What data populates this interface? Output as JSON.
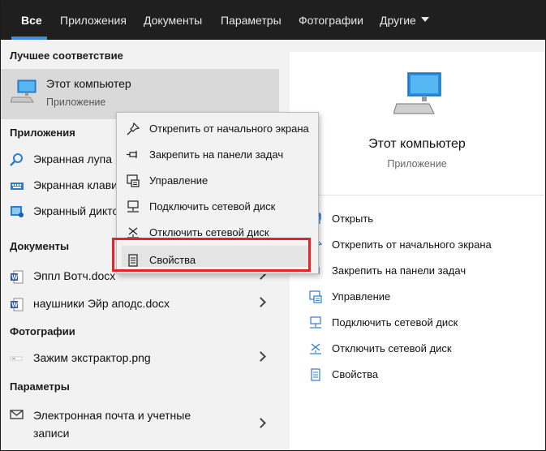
{
  "tabs": [
    {
      "label": "Все"
    },
    {
      "label": "Приложения"
    },
    {
      "label": "Документы"
    },
    {
      "label": "Параметры"
    },
    {
      "label": "Фотографии"
    },
    {
      "label": "Другие"
    }
  ],
  "left": {
    "best_match_header": "Лучшее соответствие",
    "best_match": {
      "title": "Этот компьютер",
      "subtitle": "Приложение"
    },
    "apps_header": "Приложения",
    "apps": [
      {
        "label": "Экранная лупа",
        "icon": "magnifier-icon"
      },
      {
        "label": "Экранная клавиатура",
        "icon": "keyboard-icon"
      },
      {
        "label": "Экранный диктор",
        "icon": "narrator-icon"
      }
    ],
    "docs_header": "Документы",
    "docs": [
      {
        "label": "Эппл Вотч.docx",
        "icon": "word-doc-icon"
      },
      {
        "label": "наушники Эйр аподс.docx",
        "icon": "word-doc-icon"
      }
    ],
    "photos_header": "Фотографии",
    "photos": [
      {
        "label": "Зажим экстрактор.png",
        "icon": "image-file-icon"
      }
    ],
    "settings_header": "Параметры",
    "settings": [
      {
        "label_line1": "Электронная почта и учетные",
        "label_line2": "записи",
        "icon": "mail-icon"
      }
    ]
  },
  "right": {
    "title": "Этот компьютер",
    "subtitle": "Приложение",
    "actions": [
      {
        "label": "Открыть",
        "icon": "open-icon"
      },
      {
        "label": "Открепить от начального экрана",
        "icon": "unpin-icon"
      },
      {
        "label": "Закрепить на панели задач",
        "icon": "pin-taskbar-icon"
      },
      {
        "label": "Управление",
        "icon": "manage-icon"
      },
      {
        "label": "Подключить сетевой диск",
        "icon": "map-drive-icon"
      },
      {
        "label": "Отключить сетевой диск",
        "icon": "disconnect-drive-icon"
      },
      {
        "label": "Свойства",
        "icon": "properties-icon"
      }
    ]
  },
  "context_menu": {
    "items": [
      {
        "label": "Открепить от начального экрана",
        "icon": "unpin-icon"
      },
      {
        "label": "Закрепить на панели задач",
        "icon": "pin-taskbar-icon"
      },
      {
        "label": "Управление",
        "icon": "manage-icon"
      },
      {
        "label": "Подключить сетевой диск",
        "icon": "map-drive-icon"
      },
      {
        "label": "Отключить сетевой диск",
        "icon": "disconnect-drive-icon"
      },
      {
        "label": "Свойства",
        "icon": "properties-icon"
      }
    ],
    "highlighted_item": "Свойства",
    "highlight_color": "#e0262b"
  },
  "colors": {
    "accent": "#3c8dde",
    "topbar": "#1f1f1f"
  }
}
